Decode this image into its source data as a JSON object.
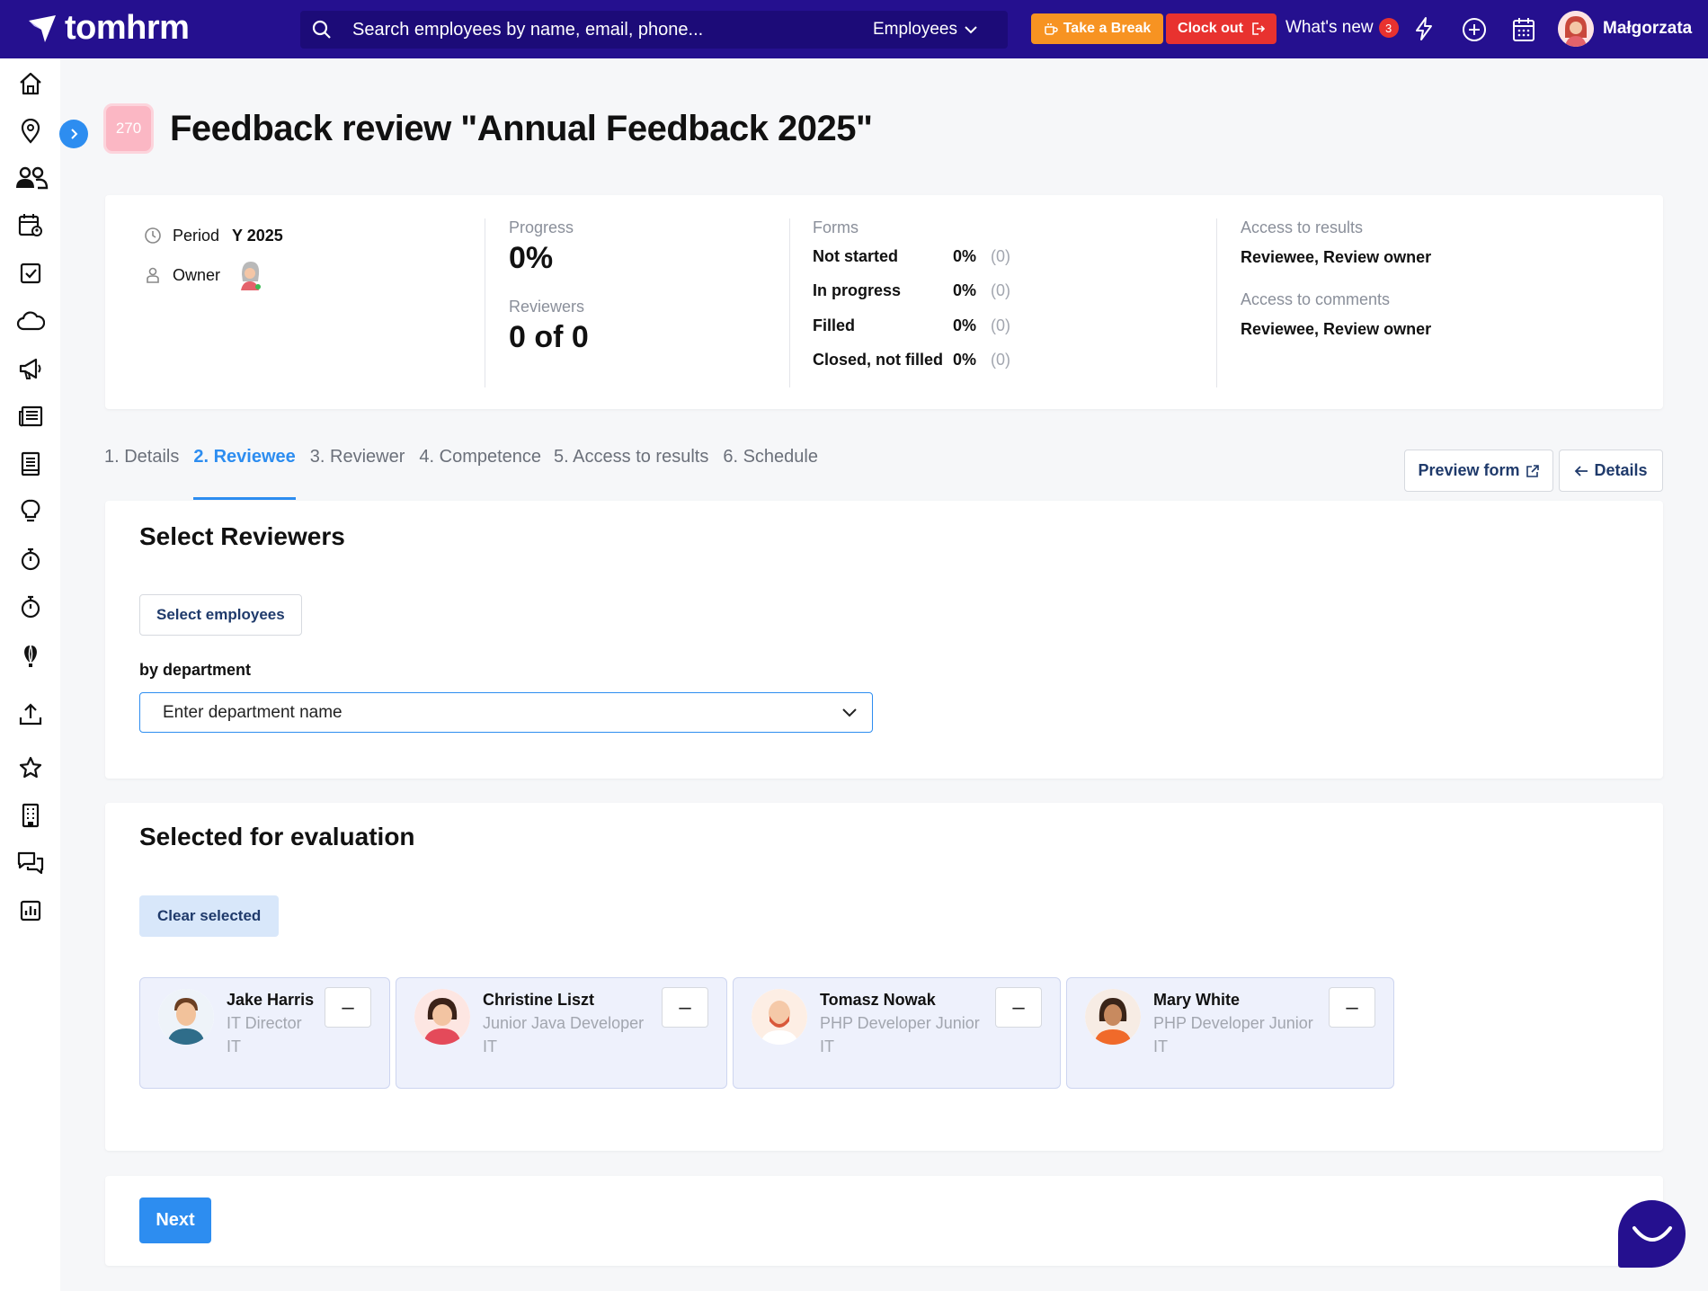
{
  "app": {
    "name": "tomhrm"
  },
  "search": {
    "placeholder": "Search employees by name, email, phone...",
    "scope": "Employees"
  },
  "topbar": {
    "take_break": "Take a Break",
    "clock_out": "Clock out",
    "whats_new": "What's new",
    "whats_new_count": "3",
    "user_name": "Małgorzata"
  },
  "page": {
    "id_badge": "270",
    "title": "Feedback review \"Annual Feedback 2025\""
  },
  "summary": {
    "period_label": "Period",
    "period_value": "Y 2025",
    "owner_label": "Owner",
    "progress_label": "Progress",
    "progress_value": "0%",
    "reviewers_label": "Reviewers",
    "reviewers_value": "0 of 0",
    "forms_label": "Forms",
    "forms": [
      {
        "name": "Not started",
        "pct": "0%",
        "count": "(0)"
      },
      {
        "name": "In progress",
        "pct": "0%",
        "count": "(0)"
      },
      {
        "name": "Filled",
        "pct": "0%",
        "count": "(0)"
      },
      {
        "name": "Closed, not filled",
        "pct": "0%",
        "count": "(0)"
      }
    ],
    "access_results_label": "Access to results",
    "access_results_value": "Reviewee, Review owner",
    "access_comments_label": "Access to comments",
    "access_comments_value": "Reviewee, Review owner"
  },
  "tabs": [
    "1. Details",
    "2. Reviewee",
    "3. Reviewer",
    "4. Competence",
    "5. Access to results",
    "6. Schedule"
  ],
  "actions": {
    "preview_form": "Preview form",
    "details": "Details"
  },
  "select_section": {
    "title": "Select Reviewers",
    "select_employees": "Select employees",
    "by_department": "by department",
    "department_placeholder": "Enter department name"
  },
  "selected_section": {
    "title": "Selected for evaluation",
    "clear_selected": "Clear selected",
    "employees": [
      {
        "name": "Jake Harris",
        "job": "IT Director",
        "dept": "IT"
      },
      {
        "name": "Christine Liszt",
        "job": "Junior Java Developer",
        "dept": "IT"
      },
      {
        "name": "Tomasz Nowak",
        "job": "PHP Developer Junior",
        "dept": "IT"
      },
      {
        "name": "Mary White",
        "job": "PHP Developer Junior",
        "dept": "IT"
      }
    ],
    "remove_label": "–"
  },
  "footer": {
    "next": "Next"
  },
  "colors": {
    "brand": "#25108f",
    "accent": "#2d8df0",
    "break": "#f79322",
    "clockout": "#e8322f"
  }
}
